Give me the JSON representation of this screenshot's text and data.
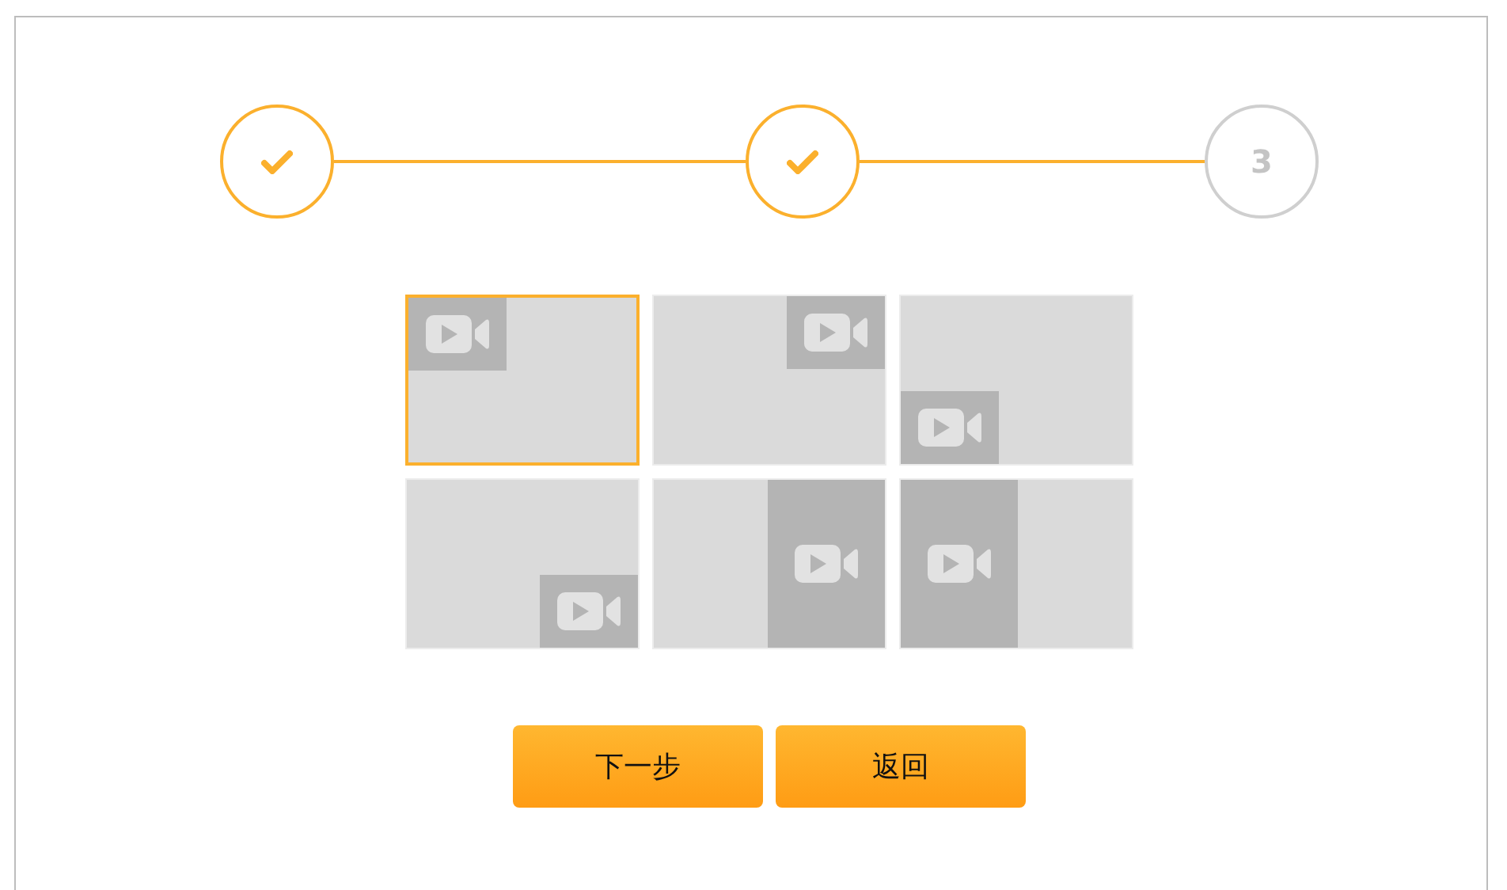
{
  "steps": [
    {
      "kind": "done"
    },
    {
      "kind": "done"
    },
    {
      "kind": "number",
      "label": "3"
    }
  ],
  "layouts": [
    {
      "kind": "top-left",
      "selected": true
    },
    {
      "kind": "top-right",
      "selected": false
    },
    {
      "kind": "bottom-left",
      "selected": false
    },
    {
      "kind": "bottom-right",
      "selected": false
    },
    {
      "kind": "right-half",
      "selected": false
    },
    {
      "kind": "left-half",
      "selected": false
    }
  ],
  "buttons": [
    "下一步",
    "返回"
  ]
}
